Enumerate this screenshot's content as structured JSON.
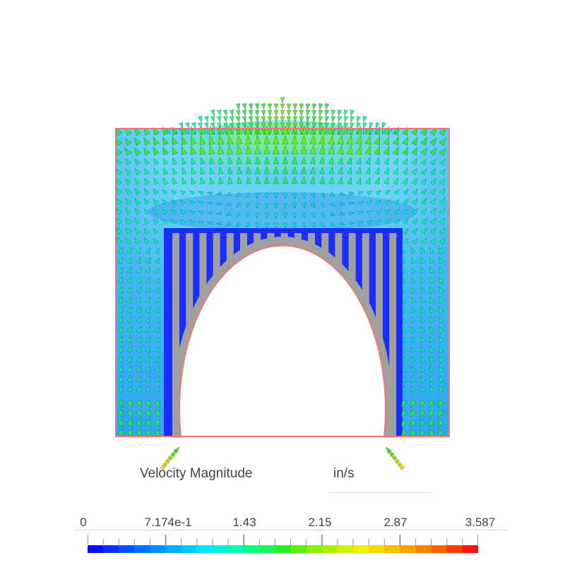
{
  "legend": {
    "title": "Velocity Magnitude",
    "units": "in/s",
    "tick_labels": [
      "0",
      "7.174e-1",
      "1.43",
      "2.15",
      "2.87",
      "3.587"
    ],
    "min": 0,
    "max": 3.587,
    "colormap": [
      "#0000ff",
      "#0050ff",
      "#00a0ff",
      "#00e6ff",
      "#00ff9a",
      "#28ee2a",
      "#9cf000",
      "#f0f000",
      "#ffb400",
      "#ff6000",
      "#ff0000"
    ]
  },
  "colors": {
    "domain_outline": "#f07878",
    "solid_body": "#a0a0a0",
    "cavity_fill": "#1a2dff",
    "background": "#ffffff"
  }
}
